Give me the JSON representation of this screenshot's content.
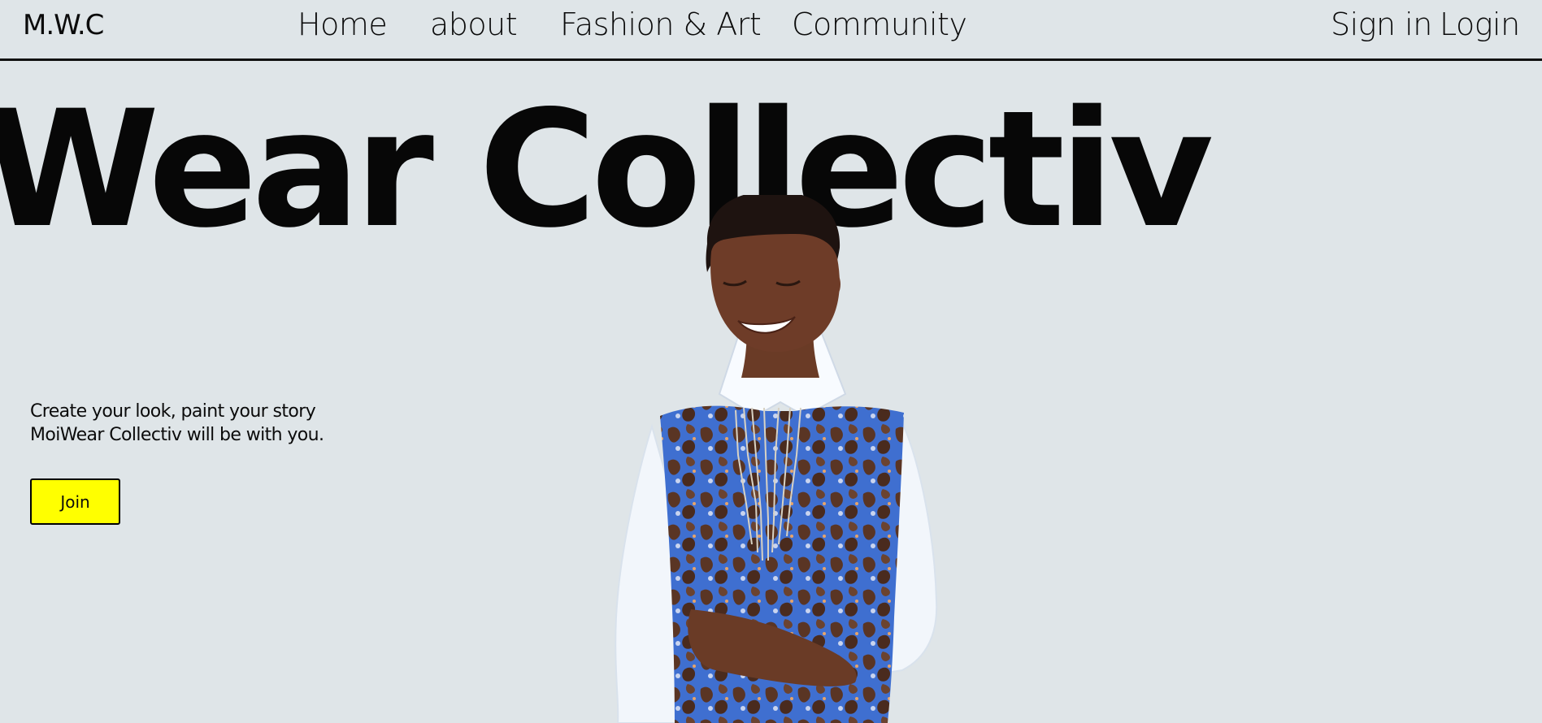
{
  "header": {
    "logo": "M.W.C",
    "nav": {
      "home": "Home",
      "about": "about",
      "fashion_art": "Fashion & Art",
      "community": "Community"
    },
    "auth": {
      "sign_in": "Sign in",
      "login": "Login"
    }
  },
  "hero": {
    "title": "Wear Collectiv",
    "tagline_line1": "Create your look, paint your story",
    "tagline_line2": "MoiWear Collectiv will be with you.",
    "join_label": "Join",
    "join_color": "#ffff00",
    "background_color": "#dfe5e8"
  }
}
